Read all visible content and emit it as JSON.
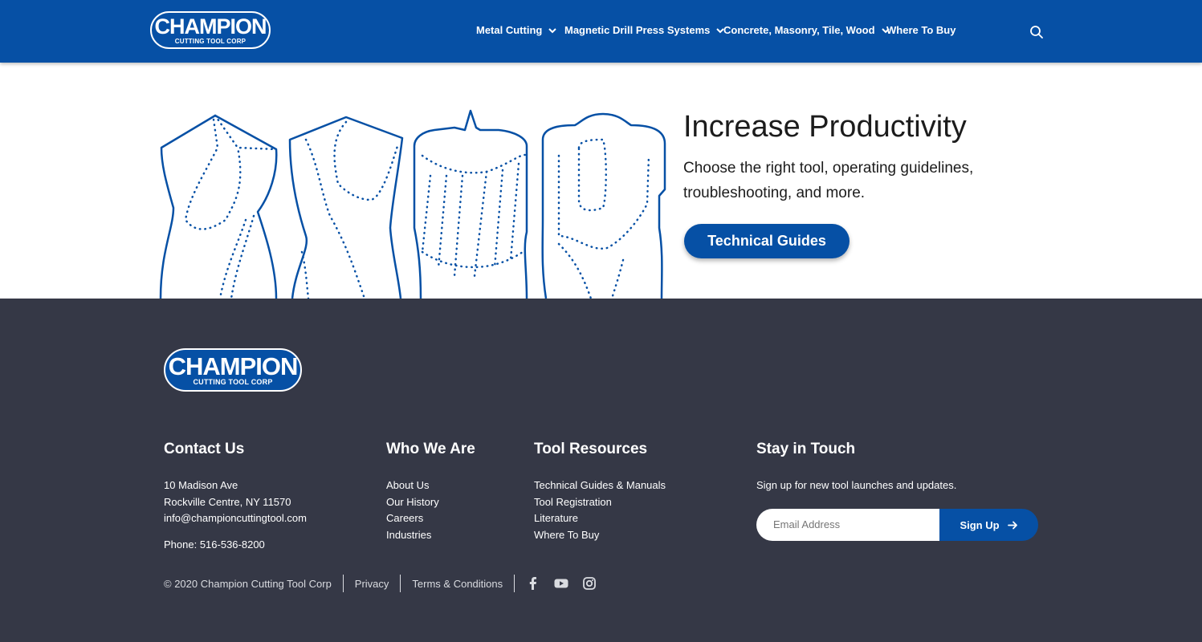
{
  "header": {
    "logo_main": "CHAMPION",
    "logo_sub": "CUTTING TOOL CORP",
    "nav": [
      {
        "label": "Metal Cutting",
        "has_dropdown": true
      },
      {
        "label": "Magnetic Drill Press Systems",
        "has_dropdown": true
      },
      {
        "label": "Concrete, Masonry, Tile, Wood",
        "has_dropdown": true
      },
      {
        "label": "Where To Buy",
        "has_dropdown": false
      }
    ],
    "search_icon": "search-icon"
  },
  "hero": {
    "title": "Increase Productivity",
    "subtitle": "Choose the right tool, operating guidelines, troubleshooting, and more.",
    "button_label": "Technical Guides"
  },
  "footer": {
    "logo_main": "CHAMPION",
    "logo_sub": "CUTTING TOOL CORP",
    "contact": {
      "heading": "Contact Us",
      "address1": "10 Madison Ave",
      "address2": "Rockville Centre, NY 11570",
      "email": "info@championcuttingtool.com",
      "phone": "Phone: 516-536-8200"
    },
    "who": {
      "heading": "Who We Are",
      "links": [
        "About Us",
        "Our History",
        "Careers",
        "Industries"
      ]
    },
    "resources": {
      "heading": "Tool Resources",
      "links": [
        "Technical Guides & Manuals",
        "Tool Registration",
        "Literature",
        "Where To Buy"
      ]
    },
    "stay": {
      "heading": "Stay in Touch",
      "text": "Sign up for new tool launches and updates.",
      "email_placeholder": "Email Address",
      "signup_label": "Sign Up"
    },
    "bottom": {
      "copyright": "© 2020 Champion Cutting Tool Corp",
      "privacy": "Privacy",
      "terms": "Terms & Conditions"
    },
    "social": [
      "facebook-icon",
      "youtube-icon",
      "instagram-icon"
    ]
  },
  "colors": {
    "brand_blue": "#0650a5",
    "footer_bg": "#353846"
  }
}
